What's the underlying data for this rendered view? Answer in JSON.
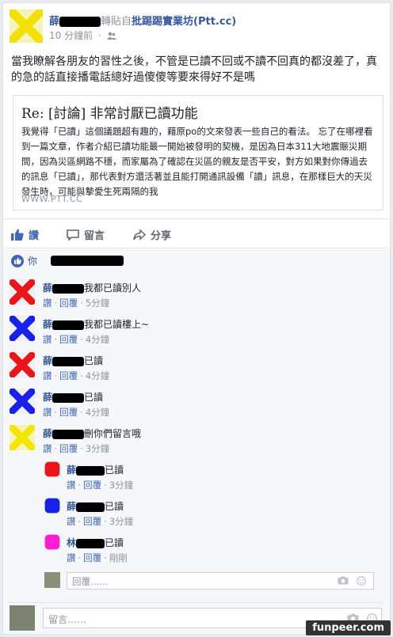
{
  "post": {
    "author": "薛",
    "via_text": "轉貼自",
    "page_name": "批踢踢實業坊(Ptt.cc)",
    "time": "10 分鐘前",
    "audience_icon": "friends-icon",
    "text": "當我瞭解各朋友的習性之後，不管是已讀不回或不讀不回真的都沒差了，真的急的話直接播電話總好過傻傻等要來得好不是嗎"
  },
  "preview": {
    "title": "Re: [討論] 非常討厭已讀功能",
    "body": "我覺得「已讀」這個議題超有趣的，藉原po的文來發表一些自己的看法。 忘了在哪裡看到一篇文章，作者介紹已讀功能最一開始被發明的契機，是因為日本311大地震賑災期間，因為災區網路不穩，而家屬為了確認在災區的親友是否平安，對方如果對你傳過去的訊息「已讀」，那代表對方還活著並且能打開通訊設備「讀」訊息，在那樣巨大的天災發生時，可能與摯愛生死兩隔的我",
    "source": "WWW.PTT.CC"
  },
  "actions": {
    "like": "讚",
    "comment": "留言",
    "share": "分享"
  },
  "likes": {
    "prefix": "你"
  },
  "comments": [
    {
      "name": "薛",
      "text": "我都已讀別人",
      "like": "讚",
      "reply": "回覆",
      "time": "5分鐘",
      "color": "#e8161b"
    },
    {
      "name": "薛",
      "text": "我都已讀樓上~",
      "like": "讚",
      "reply": "回覆",
      "time": "4分鐘",
      "color": "#1821e8"
    },
    {
      "name": "薛",
      "text": "已讀",
      "like": "讚",
      "reply": "回覆",
      "time": "4分鐘",
      "color": "#e8161b"
    },
    {
      "name": "薛",
      "text": "已讀",
      "like": "讚",
      "reply": "回覆",
      "time": "4分鐘",
      "color": "#1821e8"
    },
    {
      "name": "薛",
      "text": "刪你們留言哦",
      "like": "讚",
      "reply": "回覆",
      "time": "3分鐘",
      "color": "#f4e600"
    }
  ],
  "replies": [
    {
      "name": "薛",
      "text": "已讀",
      "like": "讚",
      "reply": "回覆",
      "time": "3分鐘",
      "color": "#e8161b"
    },
    {
      "name": "薛",
      "text": "已讀",
      "like": "讚",
      "reply": "回覆",
      "time": "3分鐘",
      "color": "#1821e8"
    },
    {
      "name": "林",
      "text": "已讀",
      "like": "讚",
      "reply": "回覆",
      "time": "剛剛",
      "color": "#ff1fd0"
    }
  ],
  "reply_box": {
    "placeholder": "回覆……"
  },
  "comment_box": {
    "placeholder": "留言……"
  },
  "watermark": "funpeer.com"
}
